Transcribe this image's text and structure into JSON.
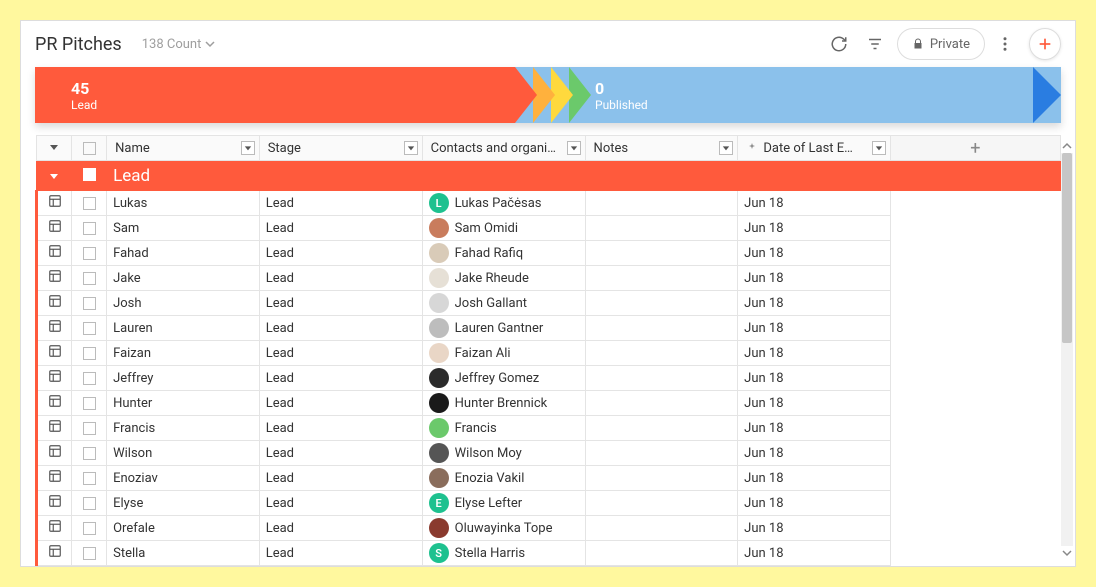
{
  "header": {
    "title": "PR Pitches",
    "count_label": "138 Count",
    "private_label": "Private"
  },
  "funnel": {
    "lead": {
      "count": "45",
      "label": "Lead"
    },
    "published": {
      "count": "0",
      "label": "Published"
    }
  },
  "columns": {
    "name": "Name",
    "stage": "Stage",
    "contacts": "Contacts and organizations",
    "notes": "Notes",
    "date": "Date of Last Email",
    "add": "+"
  },
  "group": {
    "label": "Lead"
  },
  "rows": [
    {
      "name": "Lukas",
      "stage": "Lead",
      "contact": "Lukas Pačėsas",
      "avatar_bg": "#1ec18f",
      "avatar_letter": "L",
      "date": "Jun 18"
    },
    {
      "name": "Sam",
      "stage": "Lead",
      "contact": "Sam Omidi",
      "avatar_bg": "#c97c5d",
      "avatar_letter": "",
      "date": "Jun 18"
    },
    {
      "name": "Fahad",
      "stage": "Lead",
      "contact": "Fahad Rafiq",
      "avatar_bg": "#d9cbb8",
      "avatar_letter": "",
      "date": "Jun 18"
    },
    {
      "name": "Jake",
      "stage": "Lead",
      "contact": "Jake Rheude",
      "avatar_bg": "#e6e0d6",
      "avatar_letter": "",
      "date": "Jun 18"
    },
    {
      "name": "Josh",
      "stage": "Lead",
      "contact": "Josh Gallant",
      "avatar_bg": "#d7d7d7",
      "avatar_letter": "",
      "date": "Jun 18"
    },
    {
      "name": "Lauren",
      "stage": "Lead",
      "contact": "Lauren Gantner",
      "avatar_bg": "#bdbdbd",
      "avatar_letter": "",
      "date": "Jun 18"
    },
    {
      "name": "Faizan",
      "stage": "Lead",
      "contact": "Faizan Ali",
      "avatar_bg": "#e9d6c6",
      "avatar_letter": "",
      "date": "Jun 18"
    },
    {
      "name": "Jeffrey",
      "stage": "Lead",
      "contact": "Jeffrey Gomez",
      "avatar_bg": "#2b2b2b",
      "avatar_letter": "",
      "date": "Jun 18"
    },
    {
      "name": "Hunter",
      "stage": "Lead",
      "contact": "Hunter Brennick",
      "avatar_bg": "#1a1a1a",
      "avatar_letter": "",
      "date": "Jun 18"
    },
    {
      "name": "Francis",
      "stage": "Lead",
      "contact": "Francis",
      "avatar_bg": "#6bc96b",
      "avatar_letter": "",
      "date": "Jun 18"
    },
    {
      "name": "Wilson",
      "stage": "Lead",
      "contact": "Wilson Moy",
      "avatar_bg": "#555555",
      "avatar_letter": "",
      "date": "Jun 18"
    },
    {
      "name": "Enoziav",
      "stage": "Lead",
      "contact": "Enozia Vakil",
      "avatar_bg": "#8a6d5c",
      "avatar_letter": "",
      "date": "Jun 18"
    },
    {
      "name": "Elyse",
      "stage": "Lead",
      "contact": "Elyse Lefter",
      "avatar_bg": "#1ec18f",
      "avatar_letter": "E",
      "date": "Jun 18"
    },
    {
      "name": "Orefale",
      "stage": "Lead",
      "contact": "Oluwayinka Tope",
      "avatar_bg": "#8a3a2e",
      "avatar_letter": "",
      "date": "Jun 18"
    },
    {
      "name": "Stella",
      "stage": "Lead",
      "contact": "Stella Harris",
      "avatar_bg": "#1ec18f",
      "avatar_letter": "S",
      "date": "Jun 18"
    }
  ]
}
